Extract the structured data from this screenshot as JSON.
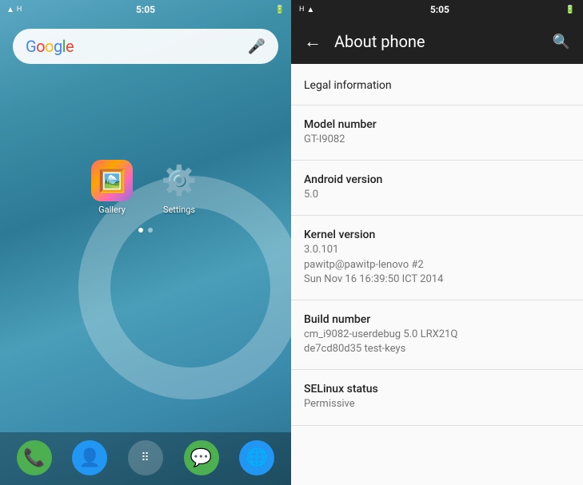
{
  "left": {
    "status_bar": {
      "time": "5:05"
    },
    "search_bar": {
      "logo": "Google",
      "mic_label": "mic"
    },
    "apps": [
      {
        "name": "Gallery",
        "icon_type": "gallery"
      },
      {
        "name": "Settings",
        "icon_type": "settings"
      }
    ],
    "dock": [
      {
        "name": "Phone",
        "icon": "📞"
      },
      {
        "name": "Contacts",
        "icon": "👥"
      },
      {
        "name": "Apps",
        "icon": "⠿"
      },
      {
        "name": "Messaging",
        "icon": "💬"
      },
      {
        "name": "Browser",
        "icon": "🌐"
      }
    ]
  },
  "right": {
    "status_bar": {
      "time": "5:05"
    },
    "header": {
      "title": "About phone",
      "back_label": "←",
      "search_label": "🔍"
    },
    "items": [
      {
        "type": "link",
        "title": "Legal information",
        "value": ""
      },
      {
        "type": "info",
        "title": "Model number",
        "value": "GT-I9082"
      },
      {
        "type": "info",
        "title": "Android version",
        "value": "5.0"
      },
      {
        "type": "info",
        "title": "Kernel version",
        "value": "3.0.101\npawitp@pawitp-lenovo #2\nSun Nov 16 16:39:50 ICT 2014"
      },
      {
        "type": "info",
        "title": "Build number",
        "value": "cm_i9082-userdebug 5.0 LRX21Q\nde7cd80d35 test-keys"
      },
      {
        "type": "info",
        "title": "SELinux status",
        "value": "Permissive"
      }
    ]
  }
}
